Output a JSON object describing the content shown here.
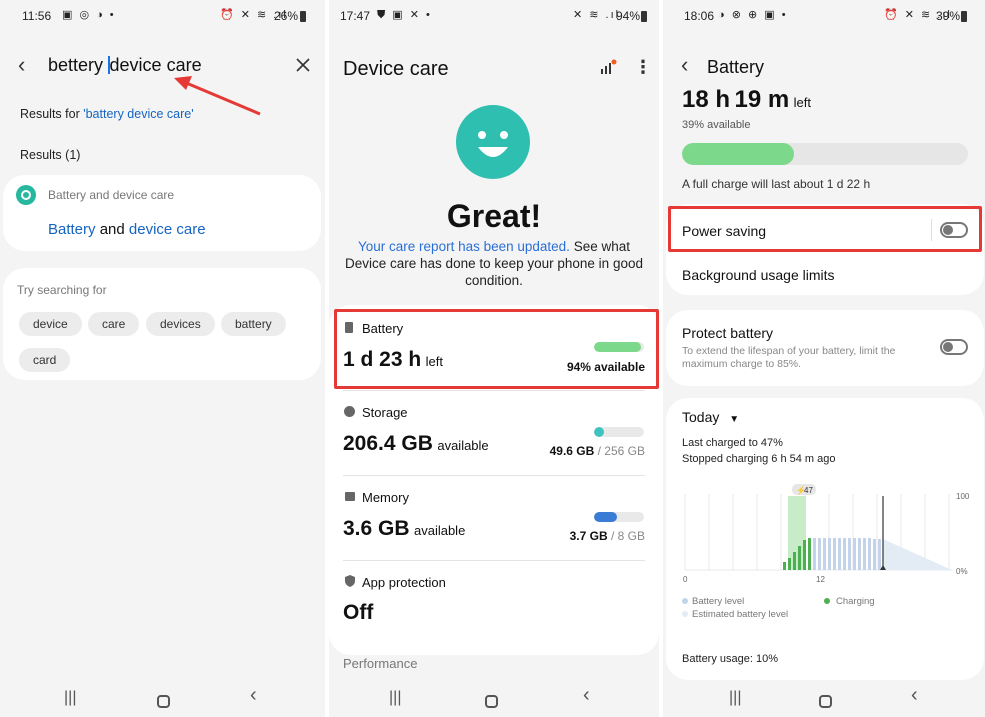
{
  "panel1": {
    "status": {
      "time": "11:56",
      "icons": "▣ ◎ ◑ •",
      "right_icons": "⏰ ✕ ≋ .ıl",
      "battery": "26%"
    },
    "search": {
      "query": "bettery device care",
      "query_part1": "bettery ",
      "query_part2": "device care"
    },
    "results_for": {
      "prefix": "Results for ",
      "term": "'battery device care'"
    },
    "results_count": "Results (1)",
    "result": {
      "category": "Battery and device care",
      "title_part1": "Battery",
      "title_part2": " and ",
      "title_part3": "device care"
    },
    "try_searching": {
      "label": "Try searching for",
      "chips": [
        "device",
        "care",
        "devices",
        "battery",
        "card"
      ]
    }
  },
  "panel2": {
    "status": {
      "time": "17:47",
      "icons": "⛊ ▣ ✕ •",
      "right_icons": "✕ ≋ .ıl",
      "battery": "94%"
    },
    "title": "Device care",
    "status_word": "Great!",
    "report_link": "Your care report has been updated.",
    "report_text": " See what Device care has done to keep your phone in good condition.",
    "battery": {
      "label": "Battery",
      "value": "1 d 23 h",
      "unit": "left",
      "available": "94% available",
      "level": 0.94,
      "color": "#7cd88a"
    },
    "storage": {
      "label": "Storage",
      "value": "206.4 GB",
      "unit": "available",
      "used": "49.6 GB",
      "total": " / 256 GB",
      "level": 0.19,
      "color": "#3fc2c2"
    },
    "memory": {
      "label": "Memory",
      "value": "3.6 GB",
      "unit": "available",
      "used": "3.7 GB",
      "total": " / 8 GB",
      "level": 0.46,
      "color": "#3a7bd5"
    },
    "app_protection": {
      "label": "App protection",
      "value": "Off"
    },
    "performance": {
      "label": "Performance"
    }
  },
  "panel3": {
    "status": {
      "time": "18:06",
      "icons": "◑ ⊗ ⊕ ▣ •",
      "right_icons": "⏰ ✕ ≋ .ıl",
      "battery": "39%"
    },
    "title": "Battery",
    "time_h": "18 h",
    "time_m": "19 m",
    "time_unit": "left",
    "available": "39% available",
    "level": 0.39,
    "full_charge": "A full charge will last about 1 d 22 h",
    "power_saving": "Power saving",
    "background_limits": "Background usage limits",
    "protect": {
      "title": "Protect battery",
      "desc": "To extend the lifespan of your battery, limit the maximum charge to 85%."
    },
    "today": {
      "label": "Today",
      "last_charged": "Last charged to 47%",
      "stopped": "Stopped charging 6 h 54 m ago",
      "badge": "47",
      "axis_0": "0",
      "axis_12": "12",
      "axis_100": "100",
      "axis_0pct": "0%",
      "legend": {
        "level": "Battery level",
        "charging": "Charging",
        "estimated": "Estimated battery level"
      },
      "usage": "Battery usage: 10%"
    }
  },
  "colors": {
    "accent": "#1565c0",
    "red_highlight": "#e53935",
    "green": "#7cd88a",
    "teal_face": "#2fbfb0"
  }
}
